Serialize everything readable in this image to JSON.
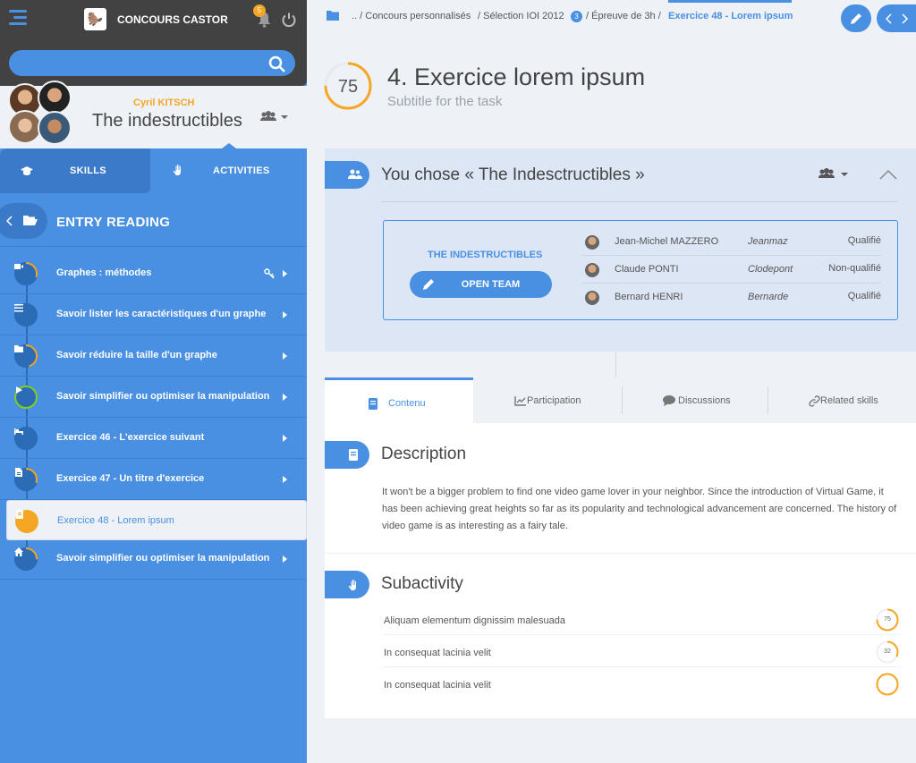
{
  "app": {
    "title": "CONCOURS CASTOR",
    "notifications": "5"
  },
  "search": {
    "value": "",
    "placeholder": ""
  },
  "profile": {
    "user": "Cyril KITSCH",
    "team": "The indestructibles"
  },
  "tabs": {
    "skills": "SKILLS",
    "activities": "ACTIVITIES"
  },
  "sidebar": {
    "section": "ENTRY READING",
    "items": [
      {
        "label": "Graphes : méthodes",
        "icon": "video-icon",
        "progress": 0.3
      },
      {
        "label": "Savoir lister les caractéristiques d'un graphe",
        "icon": "list-icon",
        "progress": 0
      },
      {
        "label": "Savoir réduire la taille d'un graphe",
        "icon": "folder-icon",
        "progress": 0.45
      },
      {
        "label": "Savoir simplifier ou optimiser la manipulation",
        "icon": "play-icon",
        "progress": 1
      },
      {
        "label": "Exercice 46 - L'exercice suivant",
        "icon": "bed-icon",
        "progress": 0
      },
      {
        "label": "Exercice 47 - Un titre d'exercice",
        "icon": "file-icon",
        "progress": 0.3
      },
      {
        "label": "Exercice 48 - Lorem ipsum",
        "icon": "book-icon",
        "progress": 0
      },
      {
        "label": "Savoir simplifier ou optimiser la manipulation",
        "icon": "home-icon",
        "progress": 0.25
      }
    ]
  },
  "breadcrumb": {
    "c1": "..  / Concours personnalisés",
    "c2": "/ Sélection IOI 2012",
    "badge": "3",
    "c3": "/ Épreuve de 3h /",
    "current": "Exercice 48 - Lorem ipsum"
  },
  "task": {
    "score": "75",
    "score_fraction": 0.75,
    "title": "4. Exercice lorem ipsum",
    "subtitle": "Subtitle for the task"
  },
  "choice": {
    "title": "You chose « The Indesctructibles »",
    "team_label": "THE INDESTRUCTIBLES",
    "open_button": "OPEN TEAM",
    "members": [
      {
        "name": "Jean-Michel MAZZERO",
        "nick": "Jeanmaz",
        "status": "Qualifié"
      },
      {
        "name": "Claude PONTI",
        "nick": "Clodepont",
        "status": "Non-qualifié"
      },
      {
        "name": "Bernard HENRI",
        "nick": "Bernarde",
        "status": "Qualifié"
      }
    ]
  },
  "content_tabs": [
    "Contenu",
    "Participation",
    "Discussions",
    "Related skills"
  ],
  "description": {
    "title": "Description",
    "text": "It won't be a bigger problem to find one video game lover in your neighbor. Since the introduction of Virtual Game, it has been achieving great heights so far as its popularity and technological advancement are concerned. The history of video game is as interesting as a fairy tale."
  },
  "subactivity": {
    "title": "Subactivity",
    "items": [
      {
        "label": "Aliquam elementum dignissim malesuada",
        "score": "75",
        "fraction": 0.75
      },
      {
        "label": "In consequat lacinia velit",
        "score": "32",
        "fraction": 0.32
      },
      {
        "label": "In consequat lacinia velit",
        "score": "",
        "fraction": 1
      }
    ]
  },
  "colors": {
    "accent": "#4a90e2",
    "orange": "#f5a623",
    "green": "#7ed321",
    "dark": "#424242"
  }
}
